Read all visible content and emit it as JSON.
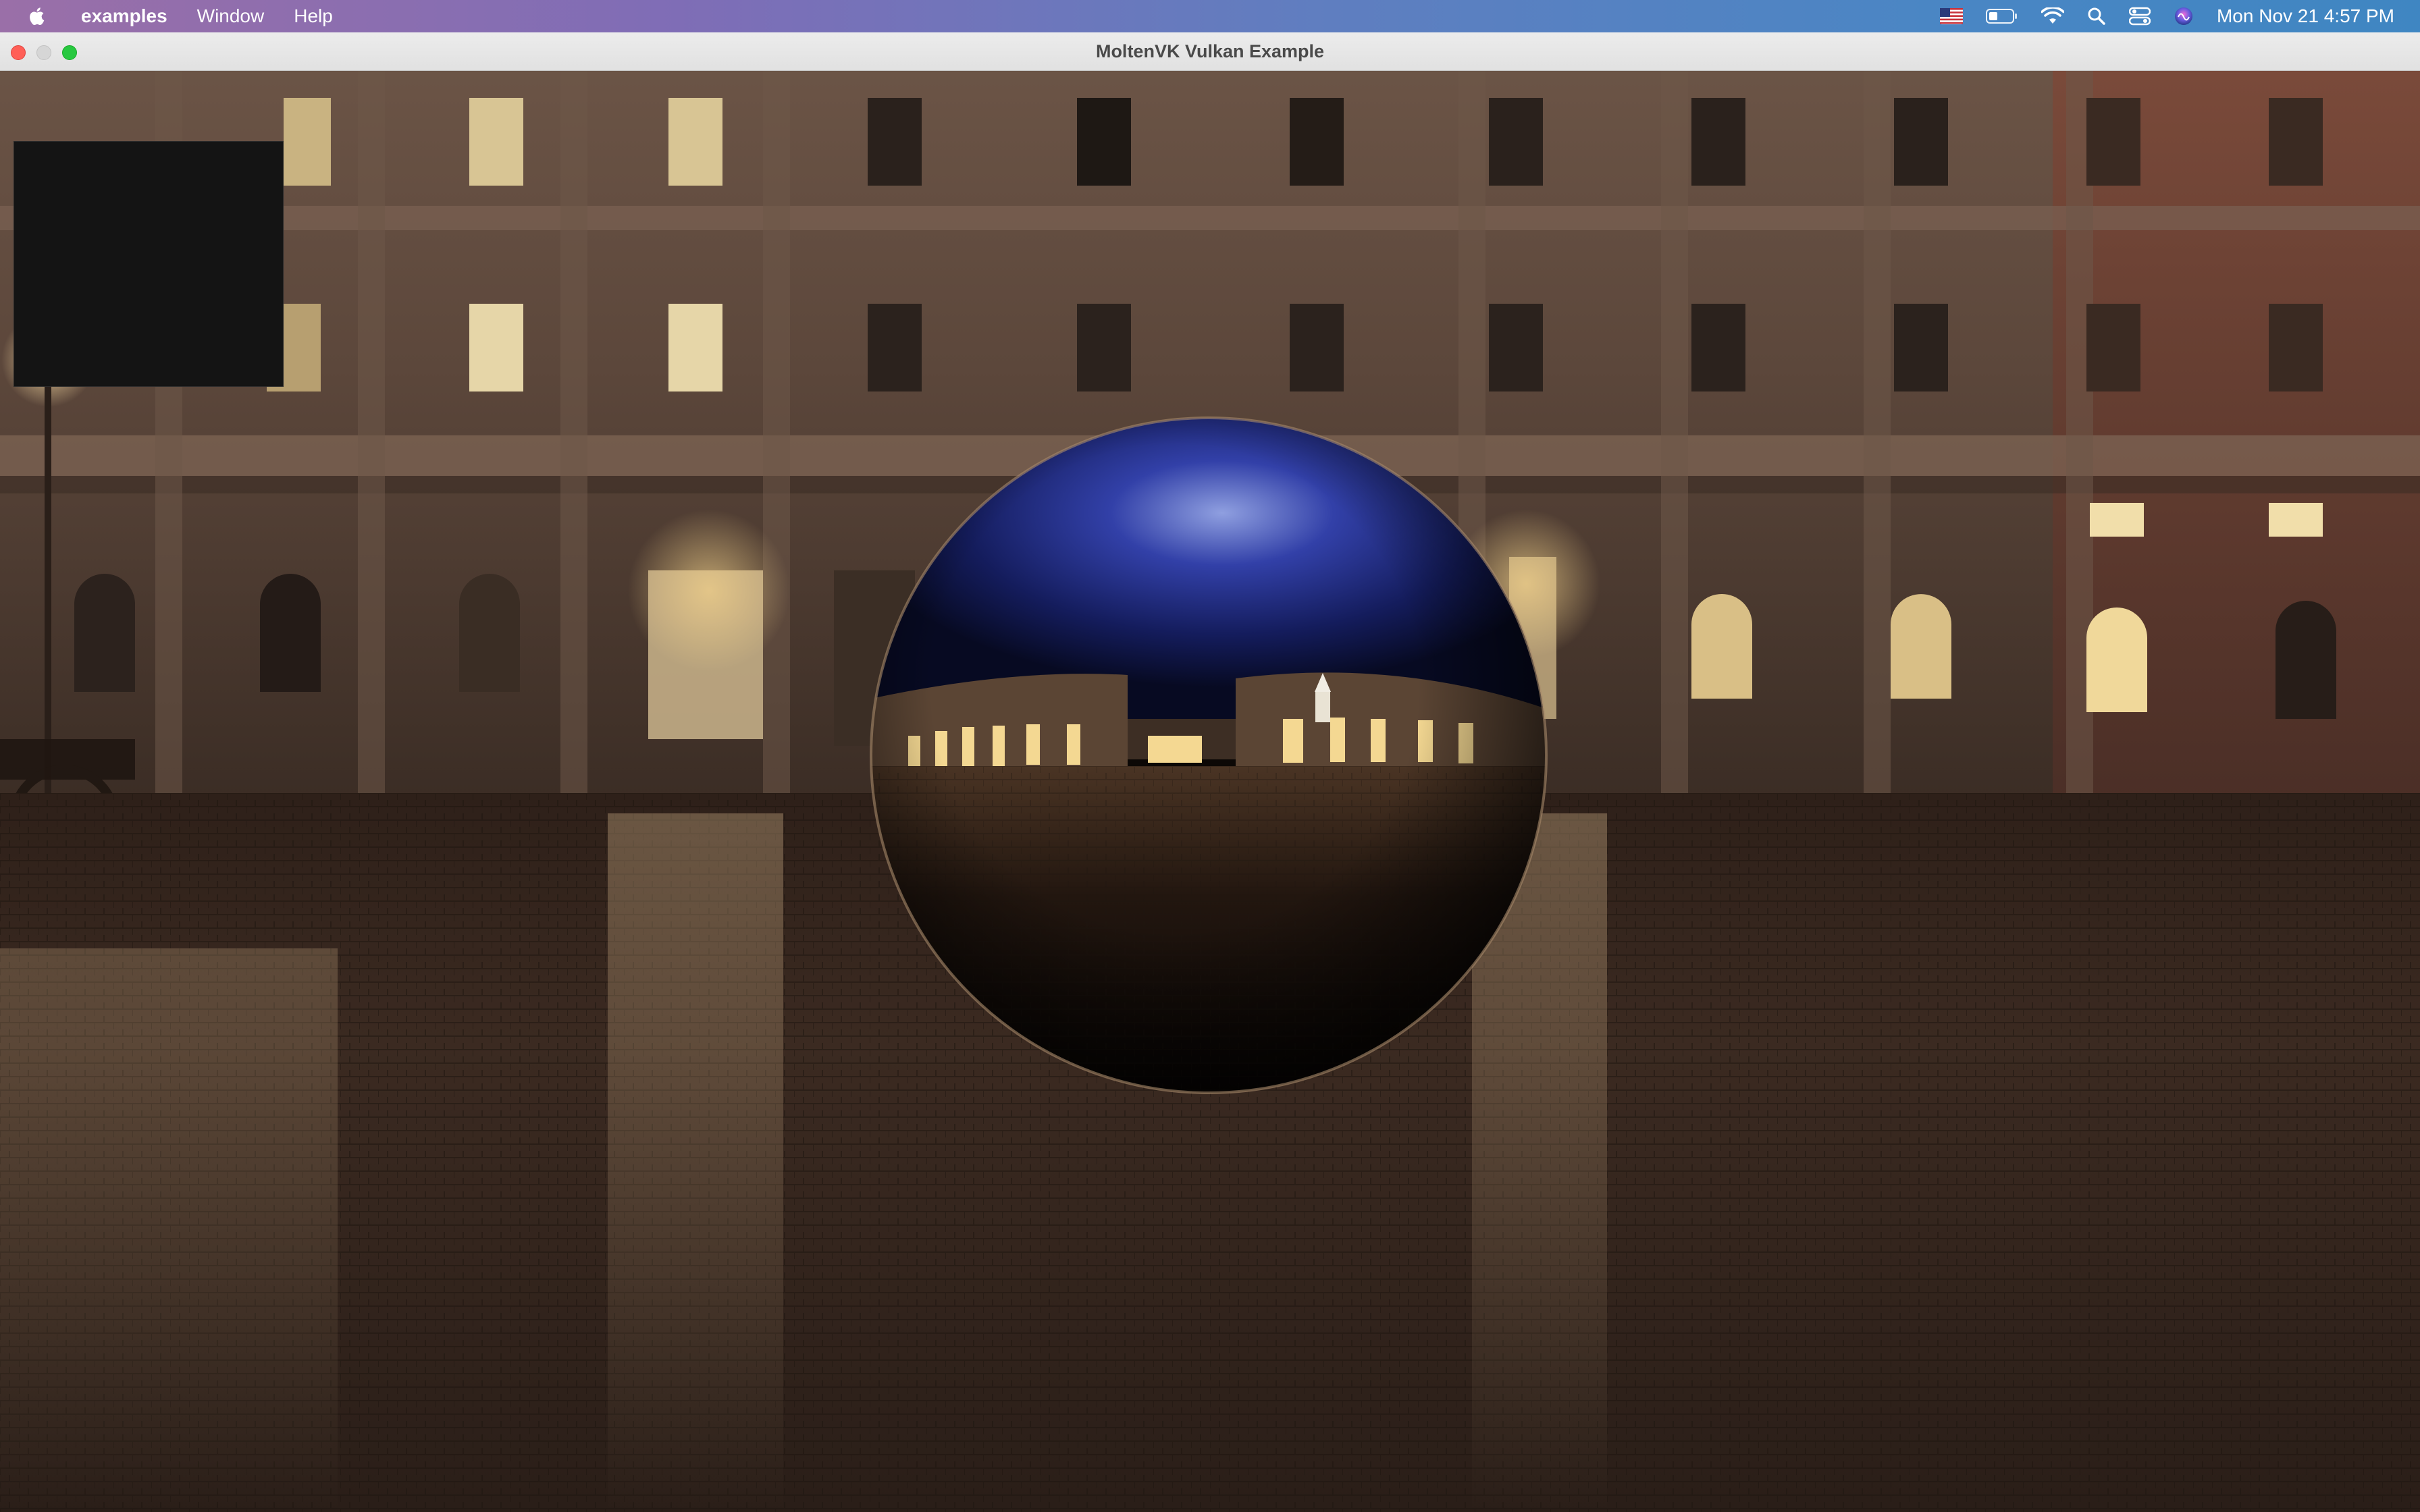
{
  "menubar": {
    "apple_icon": "apple-logo-icon",
    "items": [
      {
        "label": "examples",
        "bold": true
      },
      {
        "label": "Window",
        "bold": false
      },
      {
        "label": "Help",
        "bold": false
      }
    ],
    "status_icons": [
      "us-flag-input-icon",
      "battery-icon",
      "wifi-icon",
      "spotlight-search-icon",
      "control-center-icon",
      "siri-icon"
    ],
    "clock": "Mon Nov 21  4:57 PM"
  },
  "window": {
    "title": "MoltenVK Vulkan Example",
    "controls": [
      "close",
      "minimize",
      "zoom"
    ]
  },
  "scene": {
    "description_icon": "reflective-sphere-skybox-render"
  },
  "colors": {
    "close": "#ff5f57",
    "minimize": "#d6d6d6",
    "zoom": "#28c840",
    "overlay_panel": "#141414"
  }
}
